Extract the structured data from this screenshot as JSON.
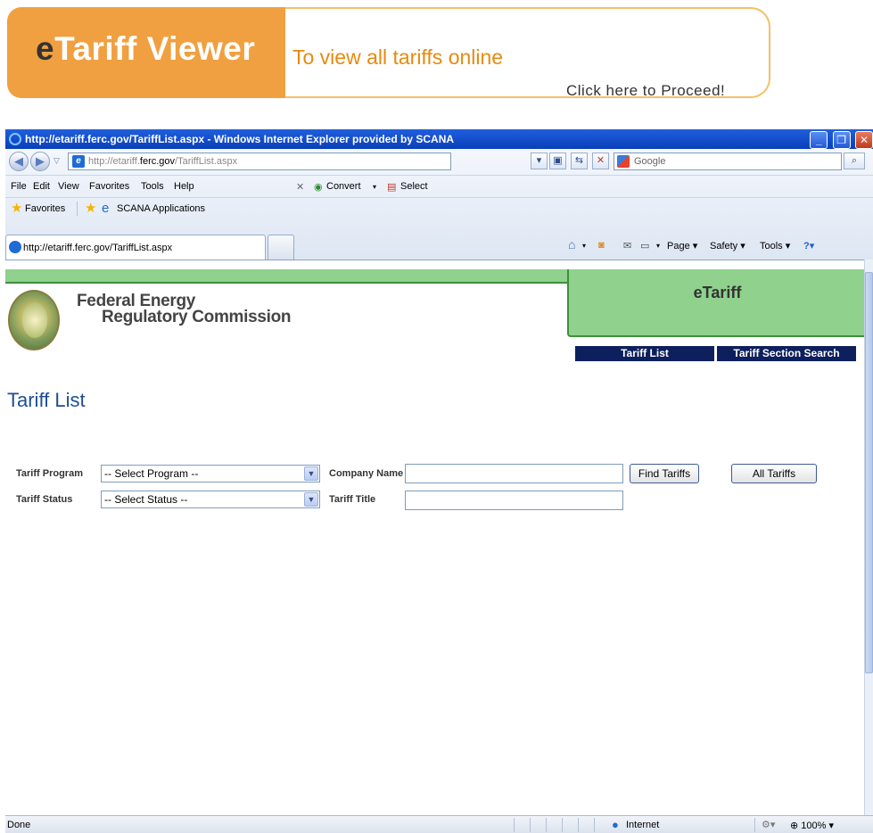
{
  "banner": {
    "title_e": "e",
    "title_rest": "Tariff Viewer",
    "subtitle": "To view all tariffs online",
    "proceed": "Click here to Proceed!"
  },
  "browser": {
    "window_title": "http://etariff.ferc.gov/TariffList.aspx - Windows Internet Explorer provided by SCANA",
    "address_prefix": "http://etariff.",
    "address_bold": "ferc.gov",
    "address_suffix": "/TariffList.aspx",
    "search_placeholder": "Google",
    "menu": [
      "File",
      "Edit",
      "View",
      "Favorites",
      "Tools",
      "Help"
    ],
    "convert_label": "Convert",
    "select_label": "Select",
    "favorites_label": "Favorites",
    "scana_label": "SCANA Applications",
    "tab_title": "http://etariff.ferc.gov/TariffList.aspx",
    "page_label": "Page",
    "safety_label": "Safety",
    "tools_label": "Tools",
    "status_left": "Done",
    "status_zone": "Internet",
    "zoom": "100%"
  },
  "page": {
    "etariff_label": "eTariff",
    "agency_line1": "Federal Energy",
    "agency_line2": "Regulatory Commission",
    "nav": {
      "tariff_list": "Tariff List",
      "tariff_section_search": "Tariff Section Search"
    },
    "title": "Tariff List",
    "form": {
      "program_label": "Tariff Program",
      "program_value": "-- Select Program --",
      "company_label": "Company Name",
      "status_label": "Tariff Status",
      "status_value": "-- Select Status --",
      "tariff_title_label": "Tariff Title",
      "find_button": "Find Tariffs",
      "all_button": "All Tariffs"
    }
  }
}
